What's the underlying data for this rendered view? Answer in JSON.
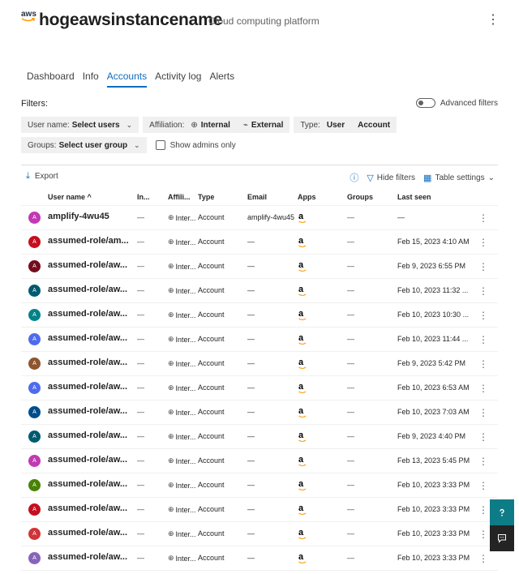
{
  "header": {
    "logo_text": "aws",
    "app_name": "hogeawsinstancename",
    "subtitle": "Cloud computing platform",
    "more_icon": "more-vertical-icon"
  },
  "tabs": [
    {
      "label": "Dashboard",
      "active": false
    },
    {
      "label": "Info",
      "active": false
    },
    {
      "label": "Accounts",
      "active": true
    },
    {
      "label": "Activity log",
      "active": false
    },
    {
      "label": "Alerts",
      "active": false
    }
  ],
  "filters": {
    "label": "Filters:",
    "advanced_label": "Advanced filters",
    "user_name_label": "User name:",
    "user_name_value": "Select users",
    "affiliation_label": "Affiliation:",
    "affiliation_internal": "Internal",
    "affiliation_external": "External",
    "type_label": "Type:",
    "type_user": "User",
    "type_account": "Account",
    "groups_label": "Groups:",
    "groups_value": "Select user group",
    "show_admins_label": "Show admins only"
  },
  "toolbar": {
    "export_label": "Export",
    "hide_filters_label": "Hide filters",
    "table_settings_label": "Table settings"
  },
  "columns": {
    "user_name": "User name ^",
    "in": "In...",
    "affiliation": "Affili...",
    "type": "Type",
    "email": "Email",
    "apps": "Apps",
    "groups": "Groups",
    "last_seen": "Last seen"
  },
  "dash": "—",
  "amazon_glyph": "a",
  "rows": [
    {
      "avatar": "A",
      "color": "#c239b3",
      "name": "amplify-4wu45",
      "in": "—",
      "affiliation": "Inter...",
      "type": "Account",
      "email": "amplify-4wu45",
      "groups": "—",
      "last_seen": "—"
    },
    {
      "avatar": "A",
      "color": "#c50f1f",
      "name": "assumed-role/am...",
      "in": "—",
      "affiliation": "Inter...",
      "type": "Account",
      "email": "—",
      "groups": "—",
      "last_seen": "Feb 15, 2023 4:10 AM"
    },
    {
      "avatar": "A",
      "color": "#750b1c",
      "name": "assumed-role/aw...",
      "in": "—",
      "affiliation": "Inter...",
      "type": "Account",
      "email": "—",
      "groups": "—",
      "last_seen": "Feb 9, 2023 6:55 PM"
    },
    {
      "avatar": "A",
      "color": "#005b70",
      "name": "assumed-role/aw...",
      "in": "—",
      "affiliation": "Inter...",
      "type": "Account",
      "email": "—",
      "groups": "—",
      "last_seen": "Feb 10, 2023 11:32 ..."
    },
    {
      "avatar": "A",
      "color": "#038387",
      "name": "assumed-role/aw...",
      "in": "—",
      "affiliation": "Inter...",
      "type": "Account",
      "email": "—",
      "groups": "—",
      "last_seen": "Feb 10, 2023 10:30 ..."
    },
    {
      "avatar": "A",
      "color": "#4f6bed",
      "name": "assumed-role/aw...",
      "in": "—",
      "affiliation": "Inter...",
      "type": "Account",
      "email": "—",
      "groups": "—",
      "last_seen": "Feb 10, 2023 11:44 ..."
    },
    {
      "avatar": "A",
      "color": "#8e562e",
      "name": "assumed-role/aw...",
      "in": "—",
      "affiliation": "Inter...",
      "type": "Account",
      "email": "—",
      "groups": "—",
      "last_seen": "Feb 9, 2023 5:42 PM"
    },
    {
      "avatar": "A",
      "color": "#4f6bed",
      "name": "assumed-role/aw...",
      "in": "—",
      "affiliation": "Inter...",
      "type": "Account",
      "email": "—",
      "groups": "—",
      "last_seen": "Feb 10, 2023 6:53 AM"
    },
    {
      "avatar": "A",
      "color": "#004e8c",
      "name": "assumed-role/aw...",
      "in": "—",
      "affiliation": "Inter...",
      "type": "Account",
      "email": "—",
      "groups": "—",
      "last_seen": "Feb 10, 2023 7:03 AM"
    },
    {
      "avatar": "A",
      "color": "#005b70",
      "name": "assumed-role/aw...",
      "in": "—",
      "affiliation": "Inter...",
      "type": "Account",
      "email": "—",
      "groups": "—",
      "last_seen": "Feb 9, 2023 4:40 PM"
    },
    {
      "avatar": "A",
      "color": "#c239b3",
      "name": "assumed-role/aw...",
      "in": "—",
      "affiliation": "Inter...",
      "type": "Account",
      "email": "—",
      "groups": "—",
      "last_seen": "Feb 13, 2023 5:45 PM"
    },
    {
      "avatar": "A",
      "color": "#498205",
      "name": "assumed-role/aw...",
      "in": "—",
      "affiliation": "Inter...",
      "type": "Account",
      "email": "—",
      "groups": "—",
      "last_seen": "Feb 10, 2023 3:33 PM"
    },
    {
      "avatar": "A",
      "color": "#c50f1f",
      "name": "assumed-role/aw...",
      "in": "—",
      "affiliation": "Inter...",
      "type": "Account",
      "email": "—",
      "groups": "—",
      "last_seen": "Feb 10, 2023 3:33 PM"
    },
    {
      "avatar": "A",
      "color": "#d13438",
      "name": "assumed-role/aw...",
      "in": "—",
      "affiliation": "Inter...",
      "type": "Account",
      "email": "—",
      "groups": "—",
      "last_seen": "Feb 10, 2023 3:33 PM"
    },
    {
      "avatar": "A",
      "color": "#8764b8",
      "name": "assumed-role/aw...",
      "in": "—",
      "affiliation": "Inter...",
      "type": "Account",
      "email": "—",
      "groups": "—",
      "last_seen": "Feb 10, 2023 3:33 PM"
    }
  ],
  "side": {
    "help_icon": "help-icon",
    "feedback_icon": "feedback-icon"
  },
  "colors": {
    "accent": "#0f6cbd",
    "side_help": "#0e7c86",
    "side_chat": "#242424"
  }
}
